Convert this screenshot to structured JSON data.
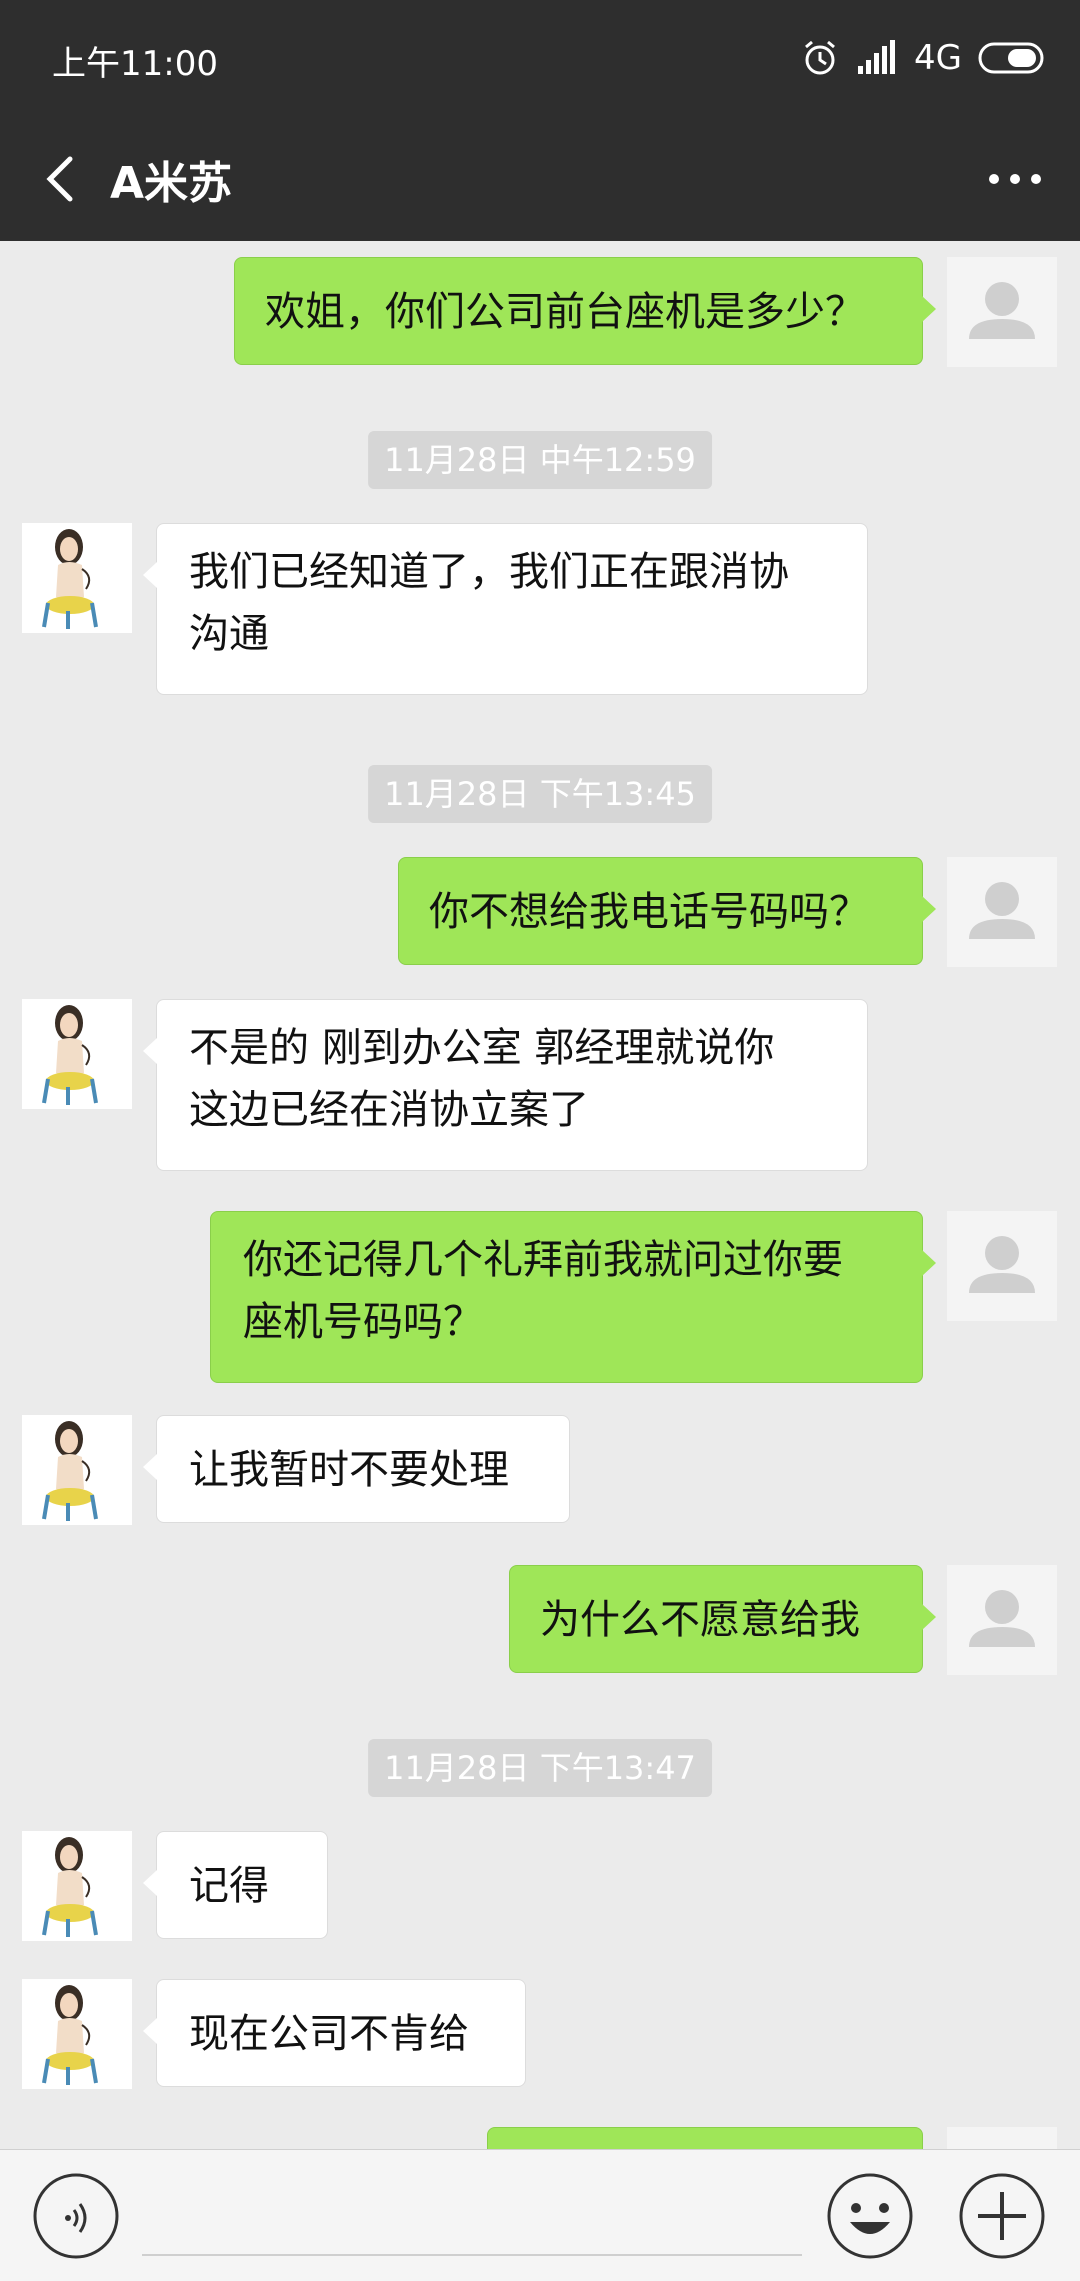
{
  "status": {
    "time": "上午11:00",
    "network": "4G"
  },
  "header": {
    "title": "A米苏"
  },
  "messages": [
    {
      "kind": "out",
      "text": "欢姐，你们公司前台座机是多少？"
    },
    {
      "kind": "time",
      "text": "11月28日 中午12:59"
    },
    {
      "kind": "in",
      "lines": [
        "我们已经知道了，我们正在跟消协",
        "沟通"
      ]
    },
    {
      "kind": "time",
      "text": "11月28日 下午13:45"
    },
    {
      "kind": "out",
      "text": "你不想给我电话号码吗？"
    },
    {
      "kind": "in",
      "lines": [
        "不是的  刚到办公室  郭经理就说你",
        "这边已经在消协立案了"
      ]
    },
    {
      "kind": "out",
      "lines": [
        "你还记得几个礼拜前我就问过你要",
        "座机号码吗？"
      ]
    },
    {
      "kind": "in",
      "text": "让我暂时不要处理"
    },
    {
      "kind": "out",
      "text": "为什么不愿意给我"
    },
    {
      "kind": "time",
      "text": "11月28日 下午13:47"
    },
    {
      "kind": "in",
      "text": "记得"
    },
    {
      "kind": "in",
      "text": "现在公司不肯给"
    }
  ],
  "icons": {
    "back": "chevron-left-icon",
    "more": "more-dots-icon",
    "voice": "voice-icon",
    "emoji": "emoji-icon",
    "add": "plus-icon",
    "alarm": "alarm-icon",
    "signal": "signal-icon",
    "battery": "battery-icon"
  },
  "colors": {
    "header_bg": "#2e2e2e",
    "chat_bg": "#ebebeb",
    "outgoing_bubble": "#9fe658",
    "incoming_bubble": "#ffffff"
  }
}
